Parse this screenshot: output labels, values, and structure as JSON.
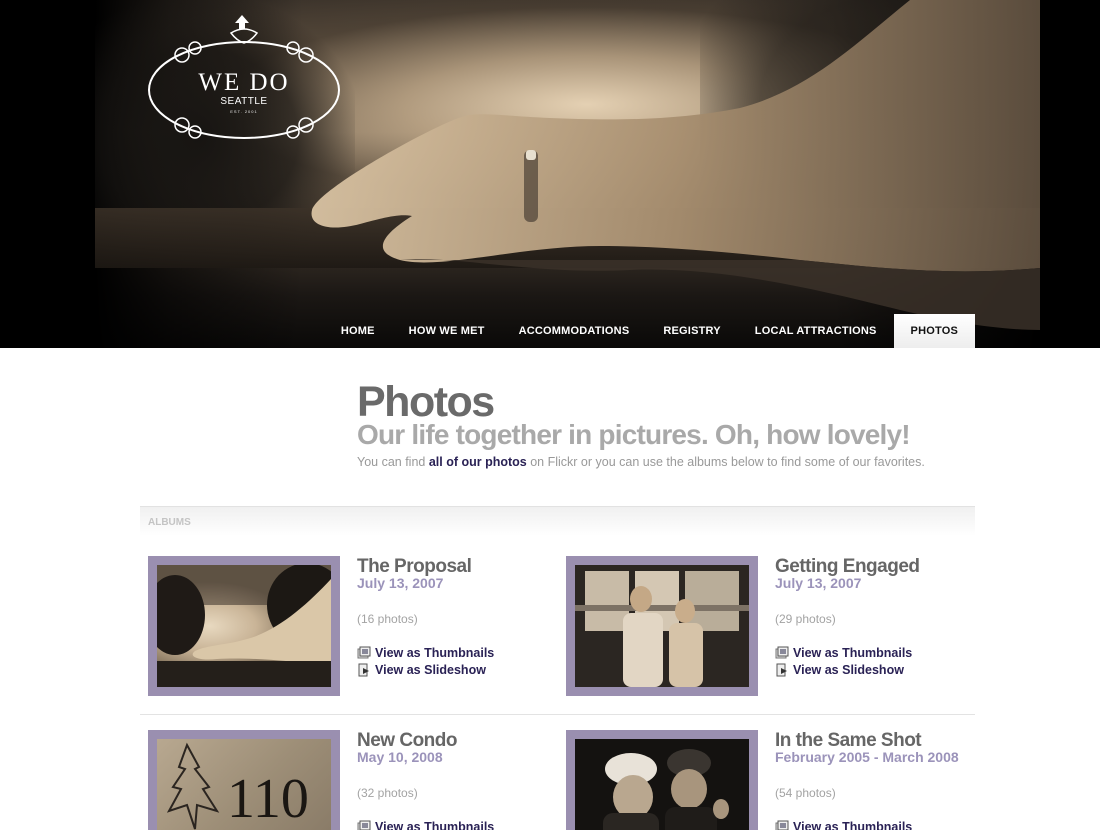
{
  "logo": {
    "title": "WE DO",
    "subtitle": "SEATTLE",
    "established": "EST. 2001"
  },
  "nav": {
    "items": [
      {
        "label": "HOME",
        "active": false
      },
      {
        "label": "HOW WE MET",
        "active": false
      },
      {
        "label": "ACCOMMODATIONS",
        "active": false
      },
      {
        "label": "REGISTRY",
        "active": false
      },
      {
        "label": "LOCAL ATTRACTIONS",
        "active": false
      },
      {
        "label": "PHOTOS",
        "active": true
      }
    ]
  },
  "page": {
    "title": "Photos",
    "tagline": "Our life together in pictures. Oh, how lovely!",
    "intro_before": "You can find ",
    "intro_link": "all of our photos",
    "intro_after": " on Flickr or you can use the albums below to find some of our favorites."
  },
  "albums": {
    "section_label": "ALBUMS",
    "thumbnails_label": "View as Thumbnails",
    "slideshow_label": "View as Slideshow",
    "items": [
      {
        "title": "The Proposal",
        "date": "July 13, 2007",
        "count": "(16 photos)",
        "photo_icon": "hand-with-ring-photo"
      },
      {
        "title": "Getting Engaged",
        "date": "July 13, 2007",
        "count": "(29 photos)",
        "photo_icon": "couple-at-window-photo"
      },
      {
        "title": "New Condo",
        "date": "May 10, 2008",
        "count": "(32 photos)",
        "photo_icon": "door-number-110-photo"
      },
      {
        "title": "In the Same Shot",
        "date": "February 2005 - March 2008",
        "count": "(54 photos)",
        "photo_icon": "two-people-winter-hats-photo"
      }
    ]
  },
  "condo_sign_text": "110",
  "colors": {
    "link": "#2a2255",
    "frame": "#9a8fb0",
    "date": "#9b93ba",
    "title_gray": "#6a6a6a"
  }
}
